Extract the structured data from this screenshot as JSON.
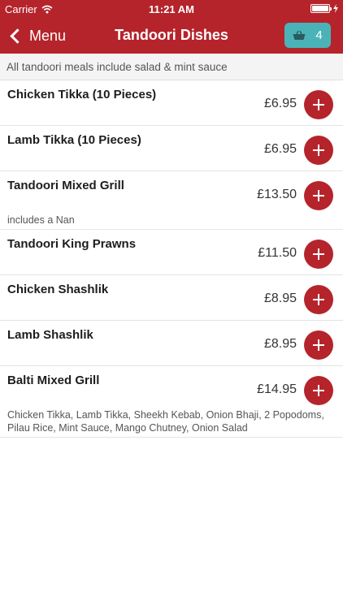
{
  "status_bar": {
    "carrier": "Carrier",
    "time": "11:21 AM"
  },
  "nav": {
    "back_label": "Menu",
    "title": "Tandoori Dishes",
    "basket_count": "4",
    "basket_icon": "basket-icon"
  },
  "notice": "All tandoori meals include salad & mint sauce",
  "colors": {
    "brand": "#b5242b",
    "basket": "#4ab3b8"
  },
  "items": [
    {
      "name": "Chicken Tikka (10 Pieces)",
      "price": "£6.95",
      "description": ""
    },
    {
      "name": "Lamb Tikka (10 Pieces)",
      "price": "£6.95",
      "description": ""
    },
    {
      "name": "Tandoori Mixed Grill",
      "price": "£13.50",
      "description": "includes a Nan"
    },
    {
      "name": "Tandoori King Prawns",
      "price": "£11.50",
      "description": ""
    },
    {
      "name": "Chicken Shashlik",
      "price": "£8.95",
      "description": ""
    },
    {
      "name": "Lamb Shashlik",
      "price": "£8.95",
      "description": ""
    },
    {
      "name": "Balti Mixed Grill",
      "price": "£14.95",
      "description": "Chicken Tikka, Lamb Tikka, Sheekh Kebab, Onion Bhaji, 2 Popodoms, Pilau Rice, Mint Sauce, Mango Chutney, Onion Salad"
    }
  ]
}
